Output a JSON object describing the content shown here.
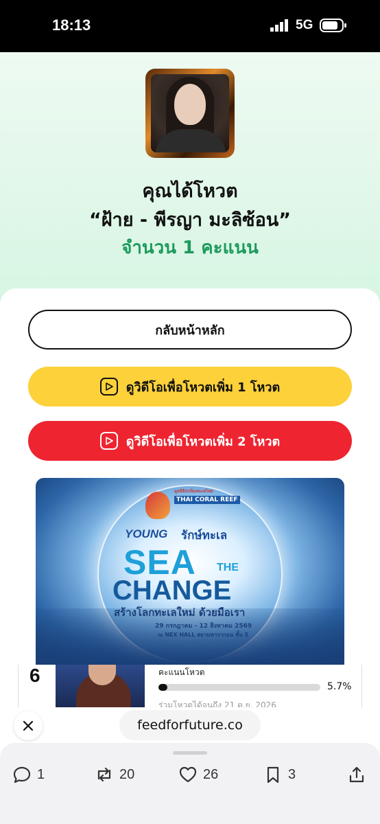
{
  "status": {
    "time": "18:13",
    "network": "5G"
  },
  "vote": {
    "title": "คุณได้โหวต",
    "candidate": "“ฝ้าย - พีรญา มะลิซ้อน”",
    "count_text": "จำนวน 1 คะแนน"
  },
  "buttons": {
    "home": "กลับหน้าหลัก",
    "watch_one": "ดูวิดีโอเพื่อโหวตเพิ่ม 1 โหวต",
    "watch_two": "ดูวิดีโอเพื่อโหวตเพิ่ม 2 โหวต"
  },
  "banner": {
    "org_th": "มูลนิธิปกป้องทะเลไทย",
    "org_en": "THAI CORAL REEF",
    "young": "YOUNG",
    "young_th": "รักษ์ทะเล",
    "sea": "SEA",
    "the": "THE",
    "change": "CHANGE",
    "slogan": "สร้างโลกทะเลใหม่ ด้วยมือเรา",
    "dates": "29 กรกฎาคม - 12 สิงหาคม 2569",
    "venue": "ณ NEX HALL สยามพารากอน ชั้น 5"
  },
  "candidate_row": {
    "rank": "6",
    "label": "คะแนนโหวต",
    "percent": 5.7,
    "percent_text": "5.7%",
    "deadline": "ร่วมโหวตได้จนถึง 21 ต.ย. 2026"
  },
  "browser": {
    "url": "feedforfuture.co"
  },
  "actions": {
    "replies": "1",
    "reposts": "20",
    "likes": "26",
    "bookmarks": "3"
  },
  "colors": {
    "green": "#1d9a5c",
    "yellow": "#fcd13a",
    "red": "#ee2431"
  }
}
